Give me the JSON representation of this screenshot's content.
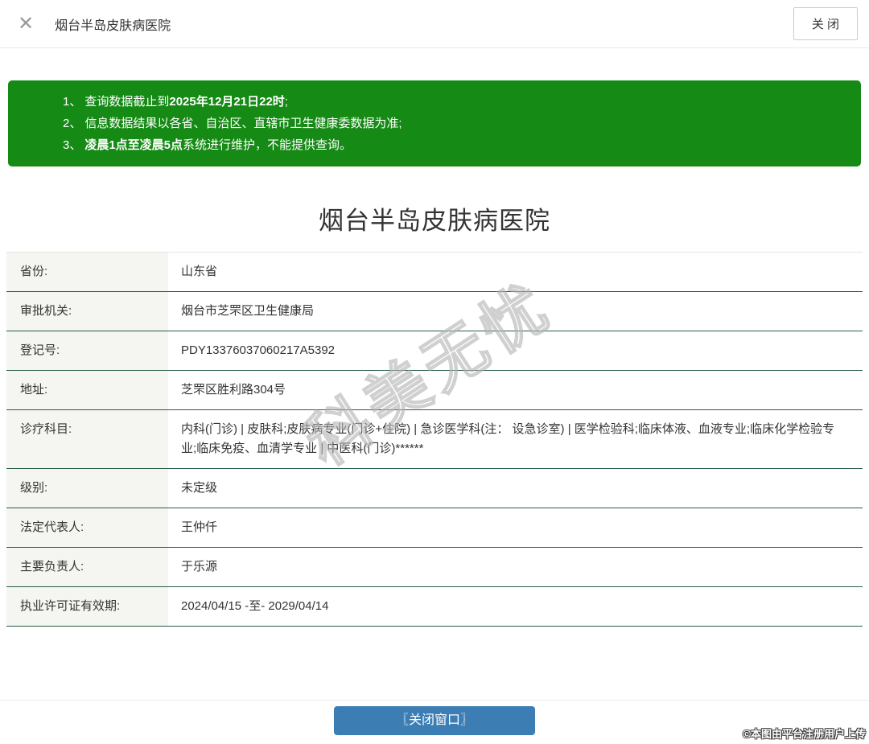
{
  "header": {
    "close_icon": "✕",
    "title": "烟台半岛皮肤病医院",
    "close_button": "关 闭"
  },
  "notice": {
    "items": [
      {
        "num": "1、",
        "pre": "查询数据截止到",
        "bold": "2025年12月21日22时",
        "post": ";"
      },
      {
        "num": "2、",
        "pre": "信息数据结果以各省、自治区、直辖市卫生健康委数据为准;",
        "bold": "",
        "post": ""
      },
      {
        "num": "3、",
        "pre": "",
        "bold": "凌晨1点至凌晨5点",
        "post": "系统进行维护，不能提供查询。"
      }
    ]
  },
  "main": {
    "title": "烟台半岛皮肤病医院",
    "rows": [
      {
        "label": "省份:",
        "value": "山东省"
      },
      {
        "label": "审批机关:",
        "value": "烟台市芝罘区卫生健康局"
      },
      {
        "label": "登记号:",
        "value": "PDY13376037060217A5392"
      },
      {
        "label": "地址:",
        "value": "芝罘区胜利路304号"
      },
      {
        "label": "诊疗科目:",
        "value": "内科(门诊) | 皮肤科;皮肤病专业(门诊+住院) | 急诊医学科(注： 设急诊室) | 医学检验科;临床体液、血液专业;临床化学检验专业;临床免疫、血清学专业 | 中医科(门诊)******"
      },
      {
        "label": "级别:",
        "value": "未定级"
      },
      {
        "label": "法定代表人:",
        "value": "王仲仟"
      },
      {
        "label": "主要负责人:",
        "value": "于乐源"
      },
      {
        "label": "执业许可证有效期:",
        "value": "2024/04/15 -至- 2029/04/14"
      }
    ]
  },
  "watermark": "科美无忧",
  "footer": {
    "close_button": "〖关闭窗口〗",
    "upload_note": "©本图由平台注册用户上传"
  },
  "colors": {
    "banner_green": "#158a15",
    "row_border": "#2a5f47",
    "button_blue": "#3c7eb4"
  }
}
